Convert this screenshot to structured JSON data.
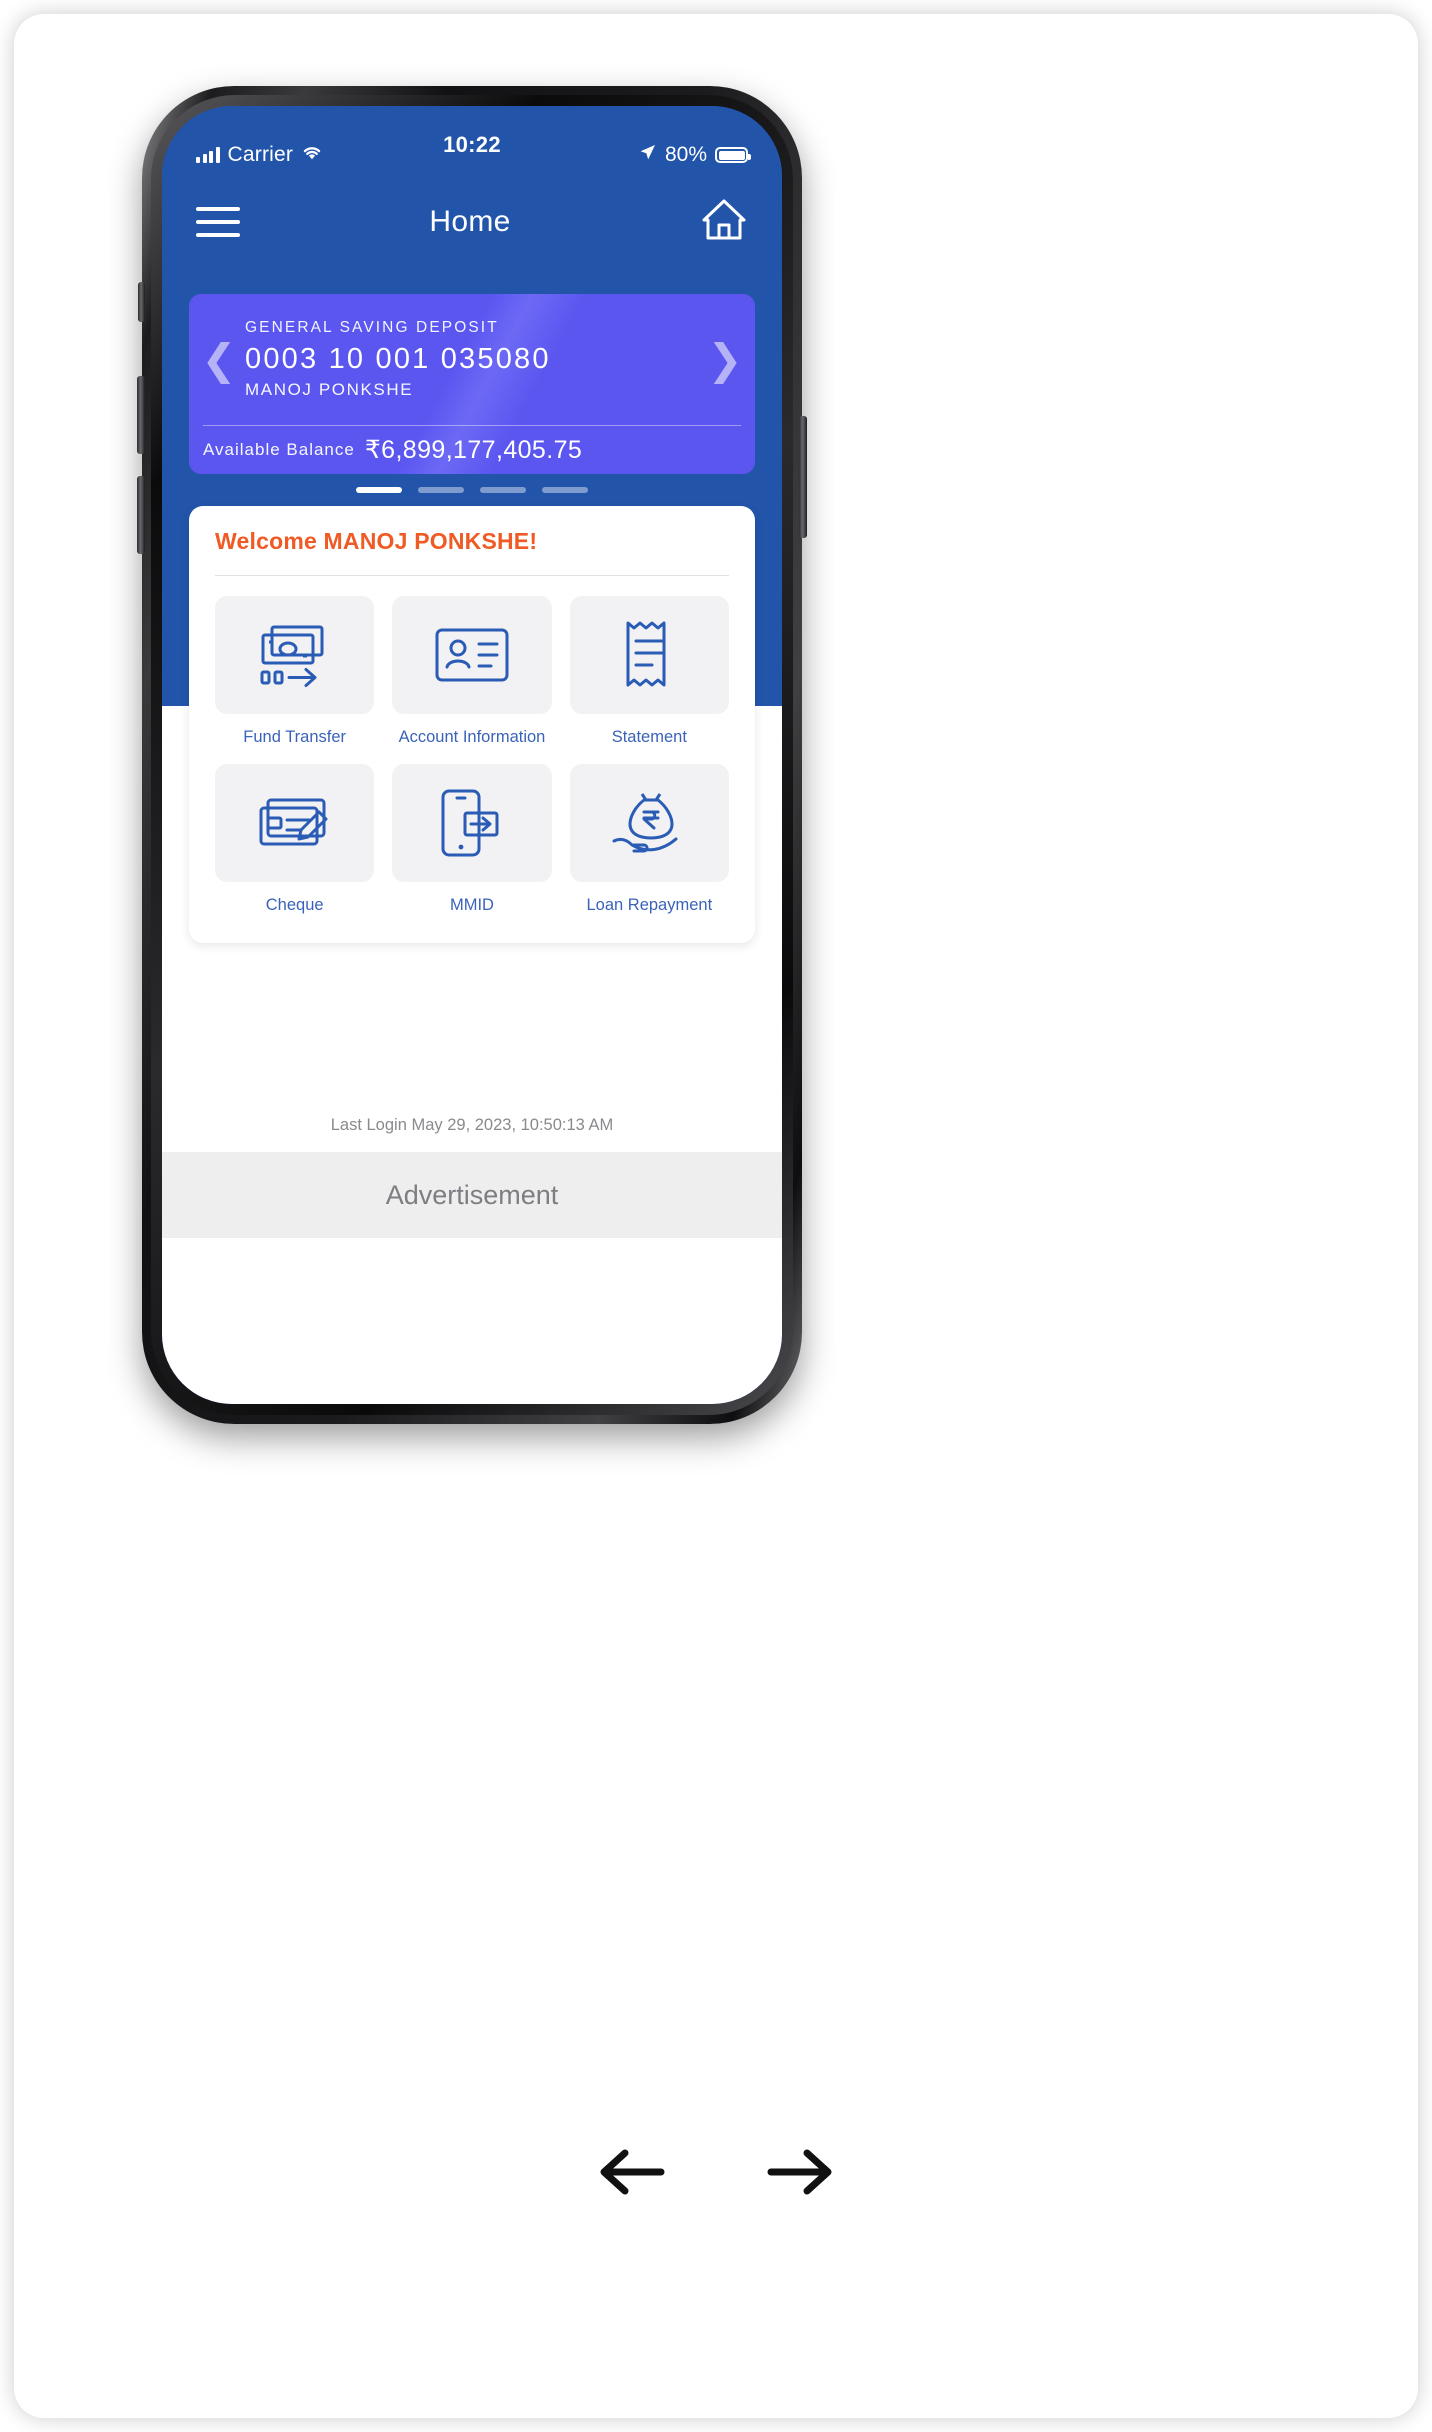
{
  "statusbar": {
    "carrier": "Carrier",
    "signal_icon": "signal-bars-icon",
    "wifi_icon": "wifi-icon",
    "time": "10:22",
    "location_icon": "location-arrow-icon",
    "battery_percent": "80%",
    "battery_icon": "battery-full-icon"
  },
  "appbar": {
    "menu_icon": "hamburger-menu-icon",
    "title": "Home",
    "home_icon": "home-icon"
  },
  "account_card": {
    "prev_icon": "chevron-left-icon",
    "next_icon": "chevron-right-icon",
    "type": "GENERAL SAVING DEPOSIT",
    "number": "0003 10 001 035080",
    "holder": "MANOJ PONKSHE",
    "balance_label": "Available Balance",
    "balance_value": "₹6,899,177,405.75",
    "card_color": "#5b56f0"
  },
  "carousel": {
    "total": 4,
    "active_index": 0
  },
  "sheet": {
    "welcome": "Welcome MANOJ PONKSHE!",
    "welcome_color": "#ef5a25",
    "tile_label_color": "#3a63b8",
    "tiles": [
      {
        "label": "Fund Transfer",
        "icon": "banknotes-transfer-icon"
      },
      {
        "label": "Account Information",
        "icon": "id-card-icon"
      },
      {
        "label": "Statement",
        "icon": "receipt-icon"
      },
      {
        "label": "Cheque",
        "icon": "cheque-pen-icon"
      },
      {
        "label": "MMID",
        "icon": "mobile-payment-icon"
      },
      {
        "label": "Loan Repayment",
        "icon": "money-bag-hand-icon"
      }
    ]
  },
  "footer": {
    "last_login": "Last Login May 29, 2023, 10:50:13 AM",
    "advertisement": "Advertisement"
  },
  "pager": {
    "back_icon": "arrow-left-icon",
    "forward_icon": "arrow-right-icon"
  },
  "theme": {
    "app_blue": "#2255aa",
    "accent_orange": "#ef5a25",
    "card_purple": "#5b56f0"
  }
}
